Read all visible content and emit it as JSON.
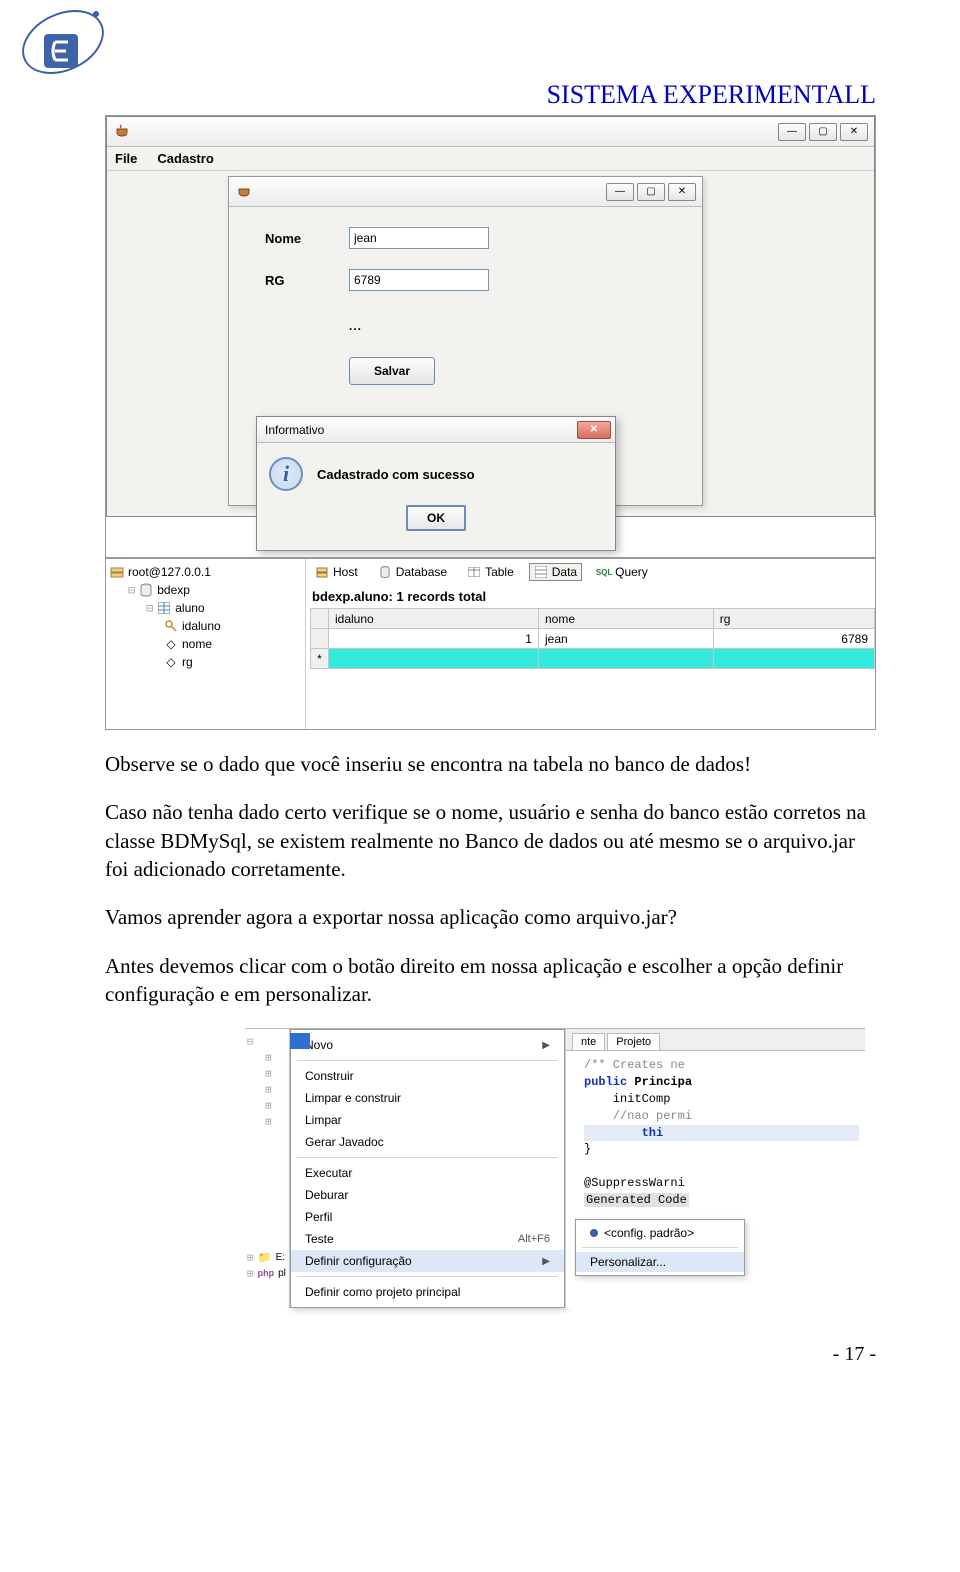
{
  "header": {
    "title": "SISTEMA EXPERIMENTALL"
  },
  "shot1": {
    "menu": {
      "file": "File",
      "cadastro": "Cadastro"
    },
    "form": {
      "nome_label": "Nome",
      "nome_value": "jean",
      "rg_label": "RG",
      "rg_value": "6789",
      "dots": "...",
      "salvar": "Salvar"
    },
    "modal": {
      "title": "Informativo",
      "message": "Cadastrado com sucesso",
      "ok": "OK"
    },
    "db": {
      "tree": {
        "root": "root@127.0.0.1",
        "db": "bdexp",
        "table": "aluno",
        "cols": [
          "idaluno",
          "nome",
          "rg"
        ]
      },
      "tabs": {
        "host": "Host",
        "database": "Database",
        "table": "Table",
        "data": "Data",
        "query": "Query"
      },
      "title": "bdexp.aluno: 1 records total",
      "columns": [
        "idaluno",
        "nome",
        "rg"
      ],
      "row": {
        "idaluno": "1",
        "nome": "jean",
        "rg": "6789"
      },
      "star": "*"
    }
  },
  "text": {
    "p1": "Observe se o dado que você inseriu se encontra na tabela no banco de dados!",
    "p2": "Caso não tenha dado certo verifique se o nome, usuário e senha do banco estão corretos na classe BDMySql, se existem realmente no Banco de dados ou até mesmo se o arquivo.jar foi adicionado corretamente.",
    "p3": "Vamos aprender agora a exportar nossa aplicação como arquivo.jar?",
    "p4": "Antes devemos clicar com o botão direito em nossa aplicação e escolher a opção definir configuração e em personalizar."
  },
  "shot2": {
    "proj_tree": {
      "nodes": [
        "E:",
        "E:",
        "pl"
      ],
      "bottom": [
        "E:",
        "pl"
      ]
    },
    "ctx_menu": [
      {
        "label": "Novo",
        "arrow": true
      },
      {
        "sep": true
      },
      {
        "label": "Construir"
      },
      {
        "label": "Limpar e construir"
      },
      {
        "label": "Limpar"
      },
      {
        "label": "Gerar Javadoc"
      },
      {
        "sep": true
      },
      {
        "label": "Executar"
      },
      {
        "label": "Deburar"
      },
      {
        "label": "Perfil"
      },
      {
        "label": "Teste",
        "shortcut": "Alt+F6"
      },
      {
        "label": "Definir configuração",
        "arrow": true,
        "hl": true
      },
      {
        "sep": true
      },
      {
        "label": "Definir como projeto principal"
      }
    ],
    "submenu": {
      "default": "<config. padrão>",
      "custom": "Personalizar..."
    },
    "src_tabs": {
      "nte": "nte",
      "projeto": "Projeto"
    },
    "code": {
      "l1_comment": "/** Creates ne",
      "l2a": "public ",
      "l2b": "Principa",
      "l3": "    initComp",
      "l4": "    //nao permi",
      "l5": "        thi",
      "l6": "}",
      "l7": "@SuppressWarni",
      "l8": "Generated Code"
    }
  },
  "footer": {
    "page": "- 17 -"
  }
}
